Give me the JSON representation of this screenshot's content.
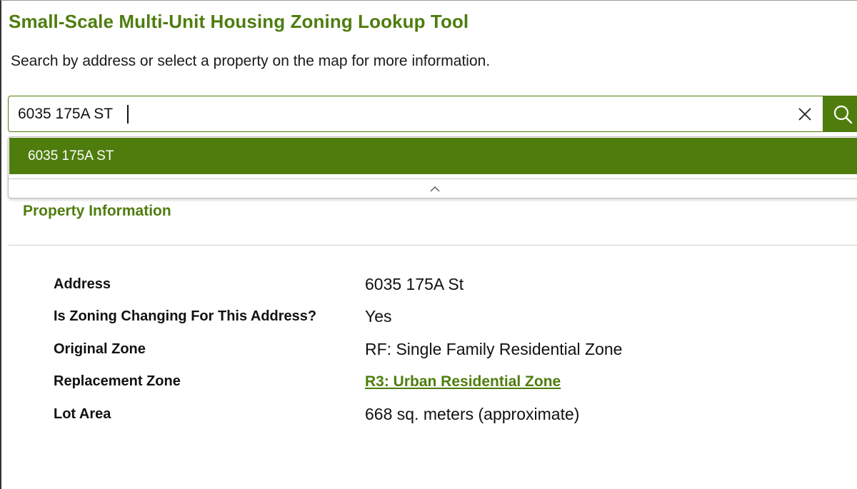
{
  "app": {
    "title": "Small-Scale Multi-Unit Housing Zoning Lookup Tool",
    "instructions": "Search by address or select a property on the map for more information."
  },
  "search": {
    "value": "6035 175A ST",
    "clear_icon": "close-icon",
    "search_icon": "search-icon",
    "suggestions": [
      "6035 175A ST"
    ],
    "collapse_icon": "chevron-up-icon"
  },
  "property": {
    "section_title": "Property Information",
    "rows": [
      {
        "label": "Address",
        "value": "6035 175A St"
      },
      {
        "label": "Is Zoning Changing For This Address?",
        "value": "Yes"
      },
      {
        "label": "Original Zone",
        "value": "RF: Single Family Residential Zone"
      },
      {
        "label": "Replacement Zone",
        "value": "R3: Urban Residential Zone",
        "is_link": true
      },
      {
        "label": "Lot Area",
        "value": "668 sq. meters (approximate)"
      }
    ]
  },
  "colors": {
    "brand_green": "#4e7d0e",
    "text": "#111111",
    "divider": "#cfcfcf"
  }
}
